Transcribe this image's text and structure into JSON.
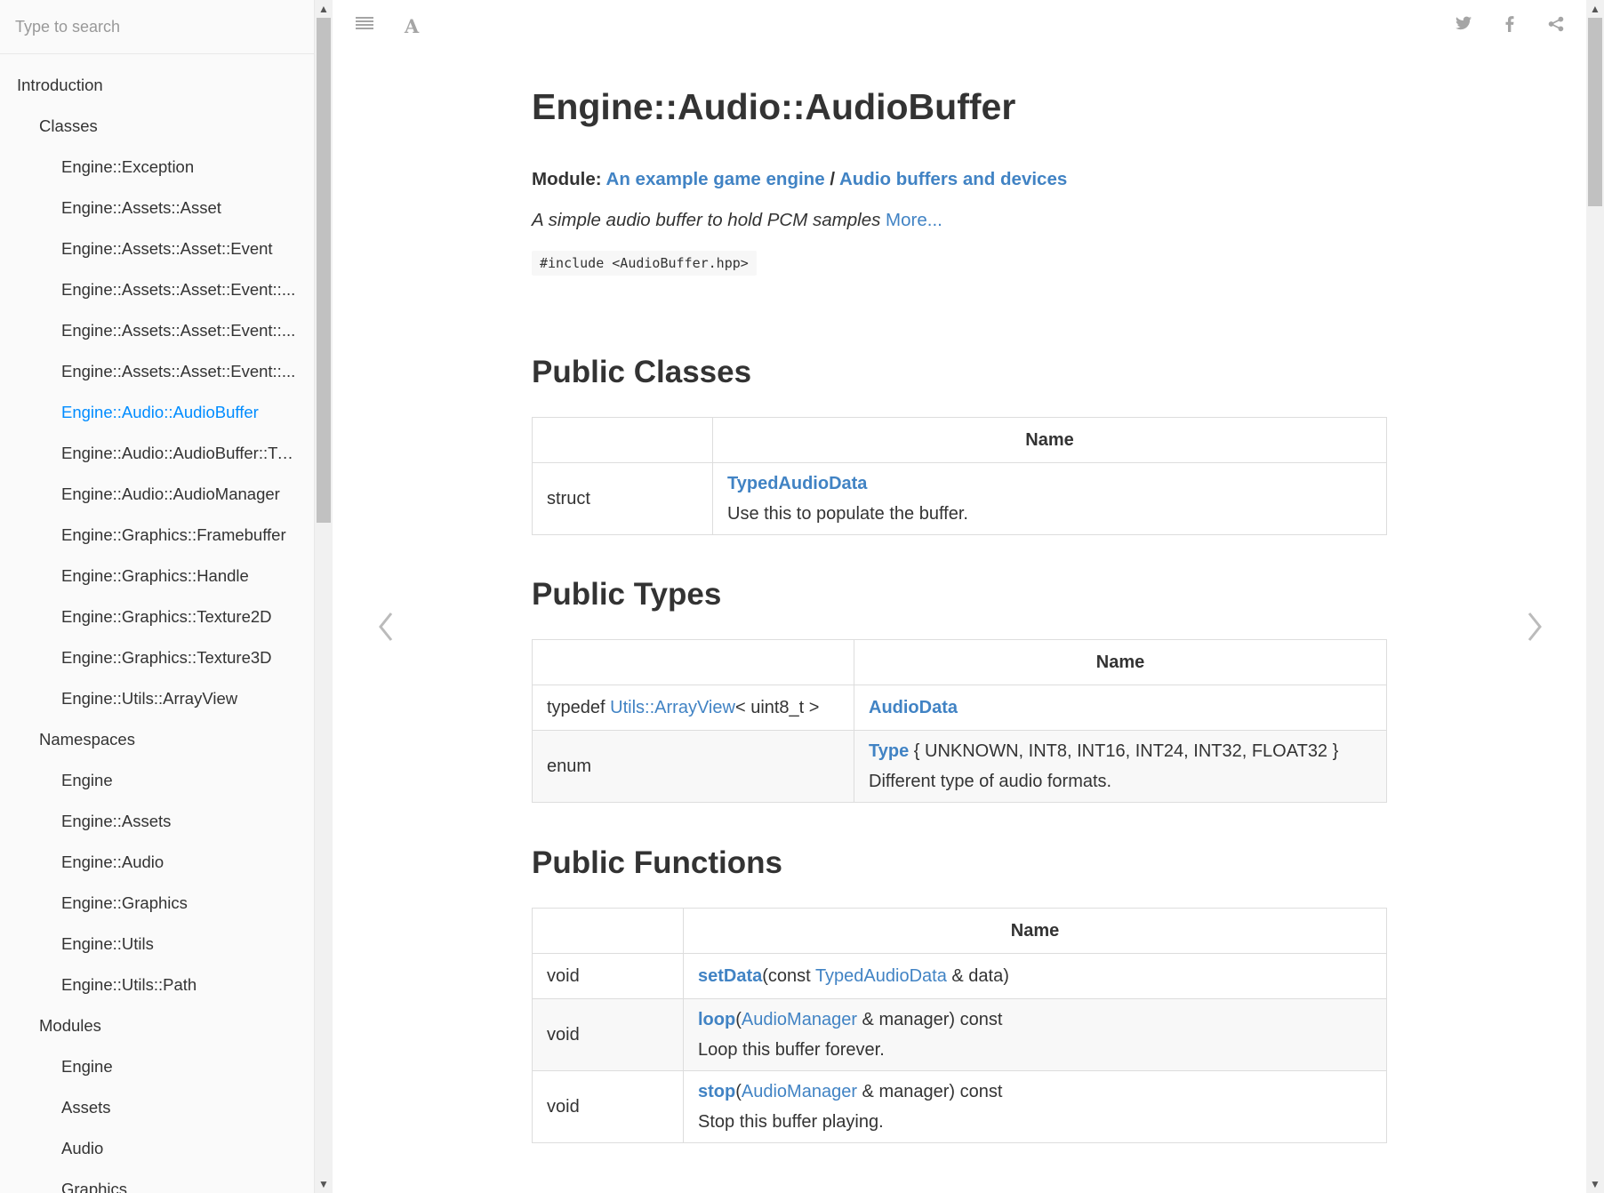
{
  "search": {
    "placeholder": "Type to search"
  },
  "sidebar": {
    "items": [
      {
        "label": "Introduction",
        "level": 1
      },
      {
        "label": "Classes",
        "level": 2
      },
      {
        "label": "Engine::Exception",
        "level": 3
      },
      {
        "label": "Engine::Assets::Asset",
        "level": 3
      },
      {
        "label": "Engine::Assets::Asset::Event",
        "level": 3
      },
      {
        "label": "Engine::Assets::Asset::Event::...",
        "level": 3
      },
      {
        "label": "Engine::Assets::Asset::Event::...",
        "level": 3
      },
      {
        "label": "Engine::Assets::Asset::Event::...",
        "level": 3
      },
      {
        "label": "Engine::Audio::AudioBuffer",
        "level": 3,
        "active": true
      },
      {
        "label": "Engine::Audio::AudioBuffer::Ty...",
        "level": 3
      },
      {
        "label": "Engine::Audio::AudioManager",
        "level": 3
      },
      {
        "label": "Engine::Graphics::Framebuffer",
        "level": 3
      },
      {
        "label": "Engine::Graphics::Handle",
        "level": 3
      },
      {
        "label": "Engine::Graphics::Texture2D",
        "level": 3
      },
      {
        "label": "Engine::Graphics::Texture3D",
        "level": 3
      },
      {
        "label": "Engine::Utils::ArrayView",
        "level": 3
      },
      {
        "label": "Namespaces",
        "level": 2
      },
      {
        "label": "Engine",
        "level": 3
      },
      {
        "label": "Engine::Assets",
        "level": 3
      },
      {
        "label": "Engine::Audio",
        "level": 3
      },
      {
        "label": "Engine::Graphics",
        "level": 3
      },
      {
        "label": "Engine::Utils",
        "level": 3
      },
      {
        "label": "Engine::Utils::Path",
        "level": 3
      },
      {
        "label": "Modules",
        "level": 2
      },
      {
        "label": "Engine",
        "level": 3
      },
      {
        "label": "Assets",
        "level": 3
      },
      {
        "label": "Audio",
        "level": 3
      },
      {
        "label": "Graphics",
        "level": 3
      }
    ]
  },
  "toolbar": {
    "menu_icon": "hamburger-icon",
    "font_icon": "A",
    "share_icons": [
      "twitter-icon",
      "facebook-icon",
      "share-icon"
    ]
  },
  "page": {
    "title": "Engine::Audio::AudioBuffer",
    "module_label": "Module:",
    "module_link_1": "An example game engine",
    "module_sep": "/",
    "module_link_2": "Audio buffers and devices",
    "brief": "A simple audio buffer to hold PCM samples",
    "more_link": "More...",
    "include": "#include <AudioBuffer.hpp>"
  },
  "public_classes": {
    "heading": "Public Classes",
    "header_name": "Name",
    "rows": [
      {
        "kind": "struct",
        "name": "TypedAudioData",
        "desc": "Use this to populate the buffer."
      }
    ]
  },
  "public_types": {
    "heading": "Public Types",
    "header_name": "Name",
    "row1": {
      "prefix": "typedef",
      "type_link": "Utils::ArrayView",
      "type_suffix": "< uint8_t >",
      "name": "AudioData"
    },
    "row2": {
      "kind": "enum",
      "name": "Type",
      "values": "{ UNKNOWN, INT8, INT16, INT24, INT32, FLOAT32 }",
      "desc": "Different type of audio formats."
    }
  },
  "public_functions": {
    "heading": "Public Functions",
    "header_name": "Name",
    "row1": {
      "ret": "void",
      "name": "setData",
      "open": "(const ",
      "param_type": "TypedAudioData",
      "rest": " & data)"
    },
    "row2": {
      "ret": "void",
      "name": "loop",
      "open": "(",
      "param_type": "AudioManager",
      "rest": " & manager) const",
      "desc": "Loop this buffer forever."
    },
    "row3": {
      "ret": "void",
      "name": "stop",
      "open": "(",
      "param_type": "AudioManager",
      "rest": " & manager) const",
      "desc": "Stop this buffer playing."
    }
  },
  "colors": {
    "link": "#4183c4",
    "active_nav": "#008cff",
    "text": "#333333"
  }
}
